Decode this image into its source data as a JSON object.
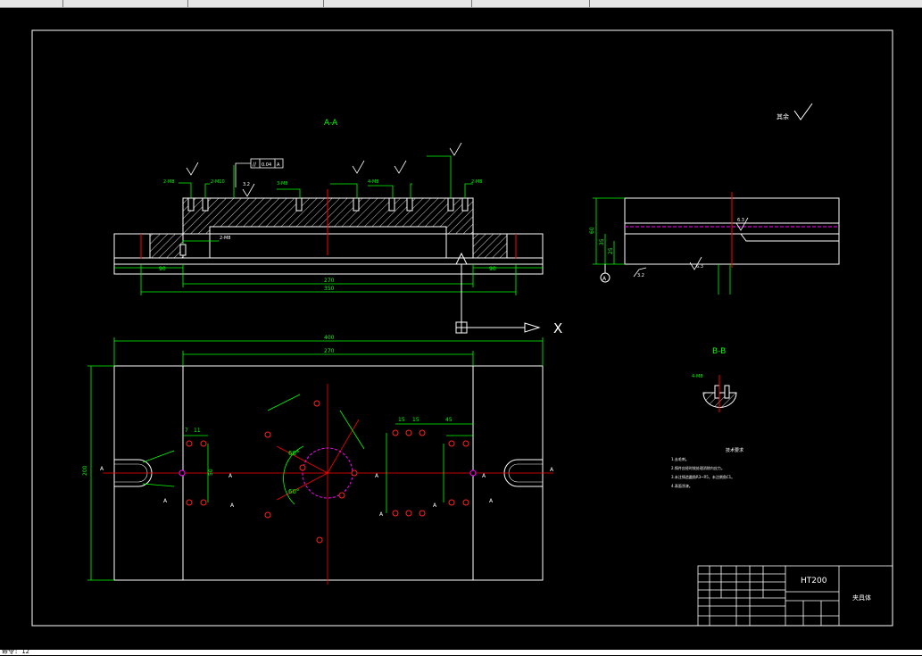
{
  "drawing": {
    "section_aa_label": "A-A",
    "section_bb_label": "B-B",
    "roughness_note": "其余",
    "material": "HT200",
    "part_name": "夹具体",
    "tech_req_title": "技术要求",
    "tech_req_lines": [
      "1.去毛刺。",
      "2.铸件应经时效处理消除内应力。",
      "3.未注铸造圆角R3~R5，未注倒角C1。",
      "4.表面涂漆。"
    ],
    "ucs_x_label": "X",
    "datum_a": "A"
  },
  "dimensions": {
    "aa_len_270": "270",
    "aa_len_350": "350",
    "aa_len_90_left": "90",
    "aa_len_90_right": "90",
    "plan_len_400": "400",
    "plan_len_270": "270",
    "plan_height": "200",
    "plan_45": "45",
    "plan_15a": "15",
    "plan_15b": "15",
    "plan_7": "7",
    "plan_11": "11",
    "plan_50": "50",
    "angle_60a": "60°",
    "angle_60b": "60°",
    "bb_side_60": "60",
    "bb_side_35": "35",
    "bb_side_25": "25"
  },
  "callouts": {
    "flatness": "0.04",
    "rough_32": "3.2",
    "rough_63": "6.3",
    "hole_2m8": "2-M8",
    "hole_3m8": "3-M8",
    "hole_4m8": "4-M8",
    "hole_2m10": "2-M10",
    "section_marker": "A"
  },
  "colors": {
    "outline": "#ffffff",
    "dimension": "#00ff00",
    "centerline": "#ff0000",
    "hidden": "#ff00ff",
    "text_green": "#00ff00",
    "hatch": "#ffffff",
    "frame": "#ffffff"
  },
  "statusbar": {
    "prompt": "命令: 12"
  }
}
